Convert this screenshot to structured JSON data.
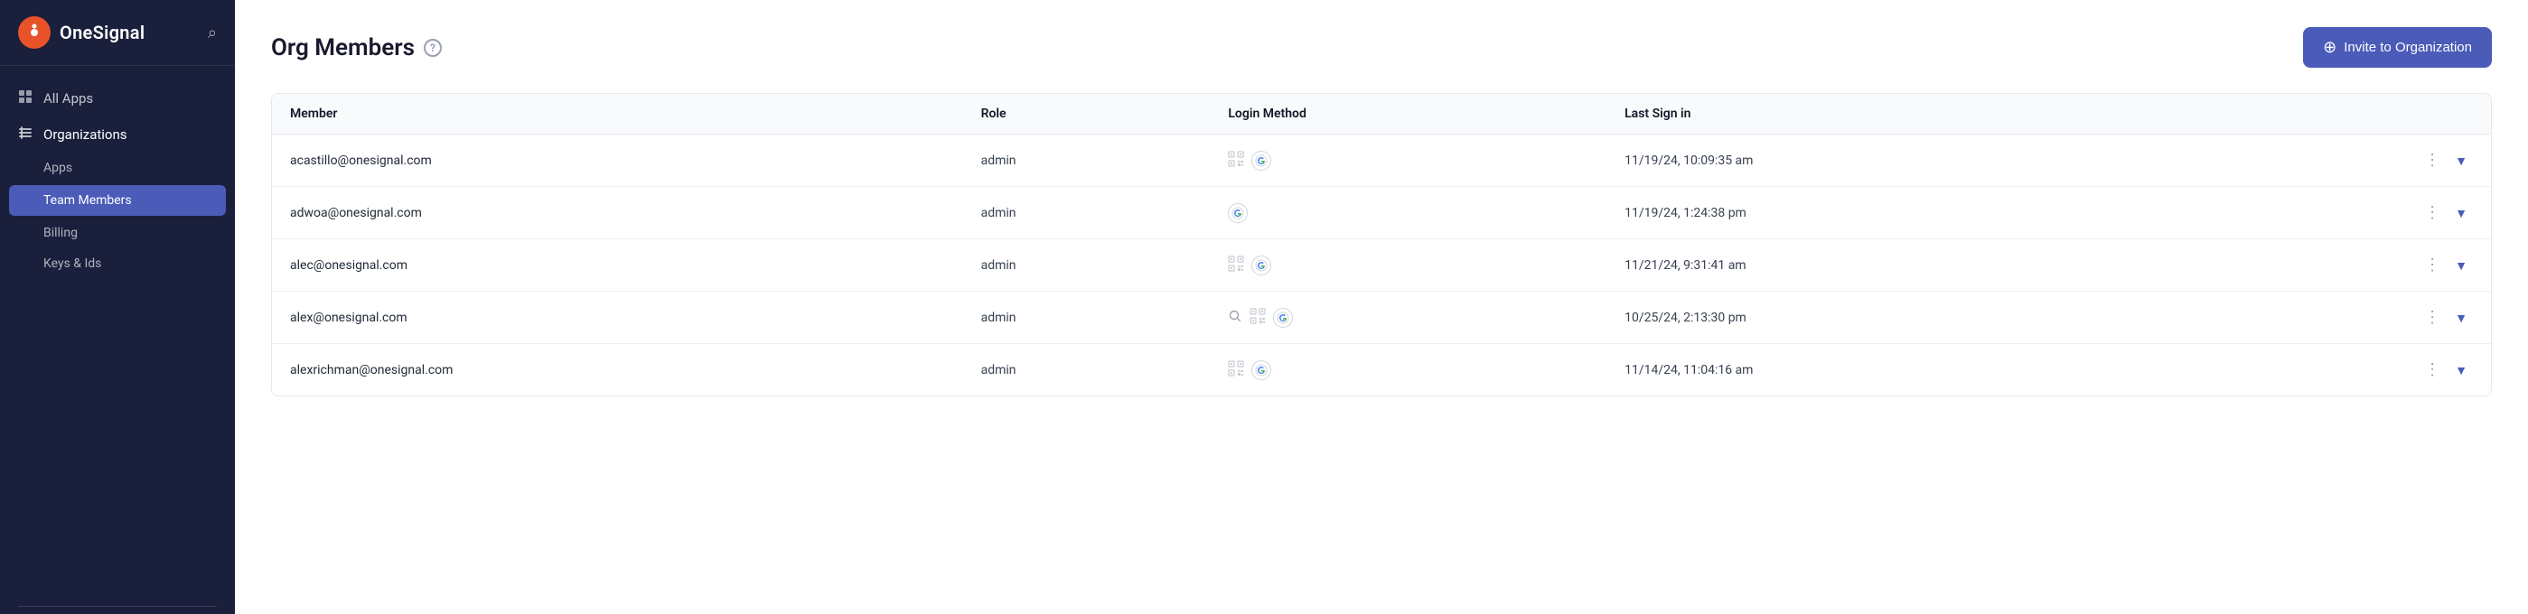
{
  "sidebar": {
    "logo": {
      "text": "OneSignal",
      "icon_letter": "O"
    },
    "nav_items": [
      {
        "id": "all-apps",
        "label": "All Apps",
        "icon": "⊞"
      },
      {
        "id": "organizations",
        "label": "Organizations",
        "icon": "⊟"
      }
    ],
    "sub_nav_items": [
      {
        "id": "apps",
        "label": "Apps",
        "active": false
      },
      {
        "id": "team-members",
        "label": "Team Members",
        "active": true
      },
      {
        "id": "billing",
        "label": "Billing",
        "active": false
      },
      {
        "id": "keys-ids",
        "label": "Keys & Ids",
        "active": false
      }
    ]
  },
  "page": {
    "title": "Org Members",
    "help_tooltip": "?",
    "invite_button": "Invite to Organization"
  },
  "table": {
    "columns": [
      {
        "id": "member",
        "label": "Member"
      },
      {
        "id": "role",
        "label": "Role"
      },
      {
        "id": "login_method",
        "label": "Login Method"
      },
      {
        "id": "last_signin",
        "label": "Last Sign in"
      }
    ],
    "rows": [
      {
        "email": "acastillo@onesignal.com",
        "role": "admin",
        "login_methods": [
          "qr",
          "google"
        ],
        "last_signin": "11/19/24, 10:09:35 am"
      },
      {
        "email": "adwoa@onesignal.com",
        "role": "admin",
        "login_methods": [
          "google"
        ],
        "last_signin": "11/19/24, 1:24:38 pm"
      },
      {
        "email": "alec@onesignal.com",
        "role": "admin",
        "login_methods": [
          "qr",
          "google"
        ],
        "last_signin": "11/21/24, 9:31:41 am"
      },
      {
        "email": "alex@onesignal.com",
        "role": "admin",
        "login_methods": [
          "search",
          "qr",
          "google"
        ],
        "last_signin": "10/25/24, 2:13:30 pm"
      },
      {
        "email": "alexrichman@onesignal.com",
        "role": "admin",
        "login_methods": [
          "qr",
          "google"
        ],
        "last_signin": "11/14/24, 11:04:16 am"
      }
    ]
  },
  "colors": {
    "sidebar_bg": "#1a1f3c",
    "active_nav": "#4a5bb8",
    "invite_btn": "#4a5bb8"
  }
}
